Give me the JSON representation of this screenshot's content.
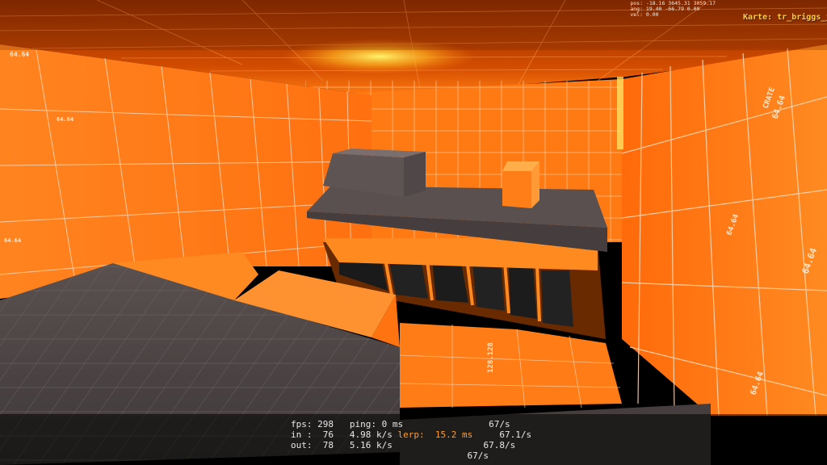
{
  "hud": {
    "position": {
      "pos_label": "pos:",
      "pos_value": "-18.16 3645.31 3059.17",
      "ang_label": "ang:",
      "ang_value": "19.40 -66.79 0.00",
      "vel_label": "vel:",
      "vel_value": "0.00"
    },
    "map": {
      "label": "Karte:",
      "name": "tr_briggs_jun"
    }
  },
  "net_graph": {
    "fps_label": "fps:",
    "fps": "298",
    "ping_label": "ping:",
    "ping": "0 ms",
    "rate1": "67/s",
    "in_label": "in :",
    "in_bytes": "76",
    "in_rate": "4.98 k/s",
    "lerp_label": "lerp:",
    "lerp_value": "15.2 ms",
    "rate2": "67.1/s",
    "out_label": "out:",
    "out_bytes": "78",
    "out_rate": "5.16 k/s",
    "rate3": "67.8/s",
    "rate4": "67/s"
  },
  "world_labels": {
    "crate_label": "CRATE",
    "crate_size": "64.64",
    "wall_size_a": "64.64",
    "wall_size_b": "128.128"
  },
  "colors": {
    "wall_orange": "#ff7a10",
    "wall_light": "#ff9a30",
    "floor_gray": "#4e4646",
    "ceiling": "#d04a00",
    "grid_line": "#ffd0a8",
    "lerp_orange": "#ff9f2a",
    "map_yellow": "#ffcf3a"
  }
}
